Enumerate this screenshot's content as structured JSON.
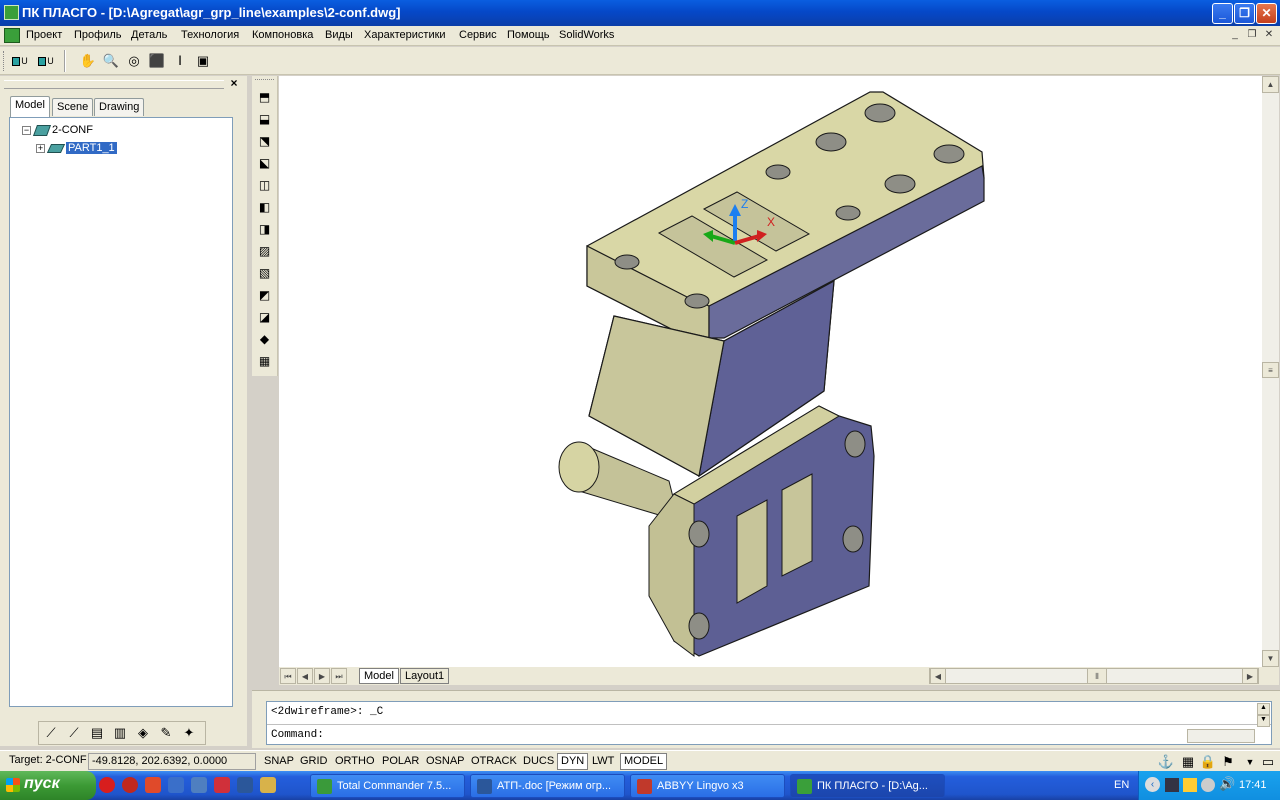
{
  "window": {
    "title": "ПК ПЛАСГО - [D:\\Agregat\\agr_grp_line\\examples\\2-conf.dwg]",
    "minimize": "_",
    "maximize": "❐",
    "close": "✕"
  },
  "menu": [
    "Проект",
    "Профиль",
    "Деталь",
    "Технология",
    "Компоновка",
    "Виды",
    "Характеристики",
    "Сервис",
    "Помощь",
    "SolidWorks"
  ],
  "mdi_controls": [
    "_",
    "❐",
    "✕"
  ],
  "toolbar": {
    "btn1": "U",
    "btn2": "U"
  },
  "left_panel": {
    "tabs": [
      "Model",
      "Scene",
      "Drawing"
    ],
    "close": "×",
    "tree": {
      "root": "2-CONF",
      "child": "PART1_1",
      "expander_root": "−",
      "expander_child": "+"
    }
  },
  "viewport": {
    "axes": {
      "z": "Z",
      "x": "X"
    },
    "layout_tabs": [
      "Model",
      "Layout1"
    ],
    "nav": [
      "⏮",
      "◀",
      "▶",
      "⏭"
    ]
  },
  "command": {
    "history": "<2dwireframe>: _C",
    "prompt": "Command:"
  },
  "status": {
    "target_label": "Target: 2-CONF",
    "coords": "-49.8128, 202.6392, 0.0000",
    "toggles": [
      "SNAP",
      "GRID",
      "ORTHO",
      "POLAR",
      "OSNAP",
      "OTRACK",
      "DUCS",
      "DYN",
      "LWT",
      "MODEL"
    ],
    "on_toggles": [
      "DYN",
      "MODEL"
    ]
  },
  "taskbar": {
    "start": "пуск",
    "tasks": [
      {
        "label": "Total Commander 7.5...",
        "color": "#3a9a3a"
      },
      {
        "label": "АТП-.doc [Режим огр...",
        "color": "#2b579a"
      },
      {
        "label": "ABBYY Lingvo x3",
        "color": "#c0392b"
      },
      {
        "label": "ПК ПЛАСГО - [D:\\Ag...",
        "color": "#3a9f3a"
      }
    ],
    "lang": "EN",
    "time": "17:41"
  },
  "colors": {
    "part_face_light": "#d6d4a2",
    "part_face_mid": "#b5b38a",
    "part_face_dark": "#5d5f93",
    "part_edge": "#2a2a2a"
  }
}
